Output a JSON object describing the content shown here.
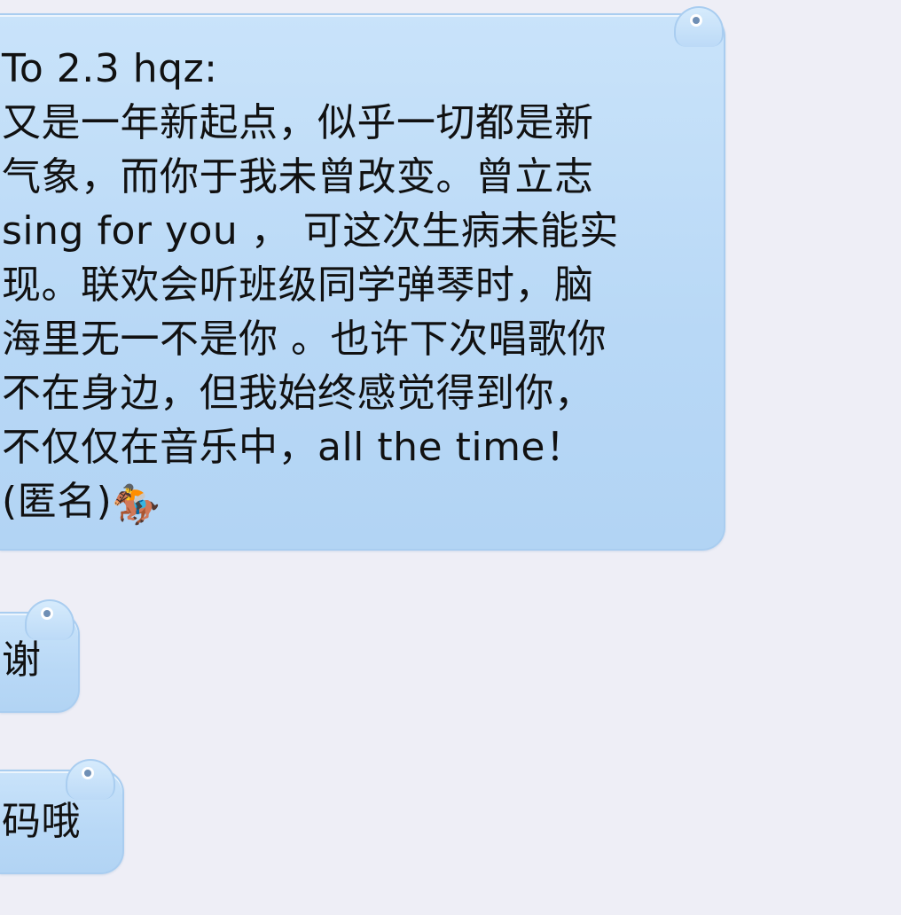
{
  "messages": [
    {
      "lines": [
        "To 2.3 hqz:",
        "又是一年新起点，似乎一切都是新",
        "气象，而你于我未曾改变。曾立志",
        "sing for you ， 可这次生病未能实",
        "现。联欢会听班级同学弹琴时，脑",
        "海里无一不是你 。也许下次唱歌你",
        "不在身边，但我始终感觉得到你，",
        "不仅仅在音乐中，all the time！",
        "(匿名)"
      ],
      "emoji": "🏇",
      "emoji_icon": "horse-racing-icon"
    },
    {
      "text": "谢"
    },
    {
      "text": "码哦"
    }
  ],
  "colors": {
    "background": "#eeeef6",
    "bubble": "#b8d8f6",
    "bubble_border": "#a9cdf0",
    "text": "#111111"
  }
}
